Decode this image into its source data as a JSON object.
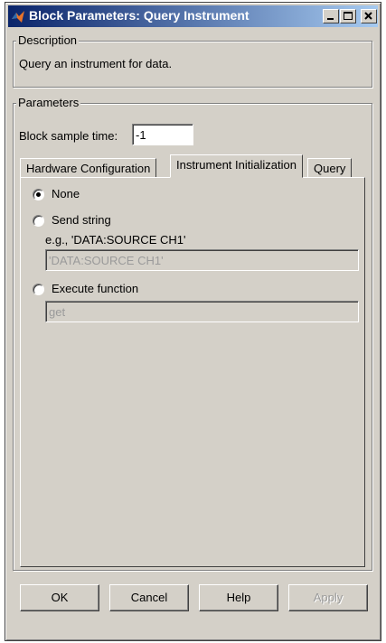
{
  "window": {
    "title": "Block Parameters: Query Instrument"
  },
  "description": {
    "legend": "Description",
    "text": "Query an instrument for data."
  },
  "parameters": {
    "legend": "Parameters",
    "sample_time_label": "Block sample time:",
    "sample_time_value": "-1",
    "tabs": [
      {
        "label": "Hardware Configuration"
      },
      {
        "label": "Instrument Initialization"
      },
      {
        "label": "Query"
      }
    ],
    "options": {
      "none_label": "None",
      "send_string_label": "Send string",
      "send_string_hint": "e.g., 'DATA:SOURCE CH1'",
      "send_string_value": "'DATA:SOURCE CH1'",
      "execute_label": "Execute function",
      "execute_value": "get"
    }
  },
  "buttons": {
    "ok": "OK",
    "cancel": "Cancel",
    "help": "Help",
    "apply": "Apply"
  }
}
